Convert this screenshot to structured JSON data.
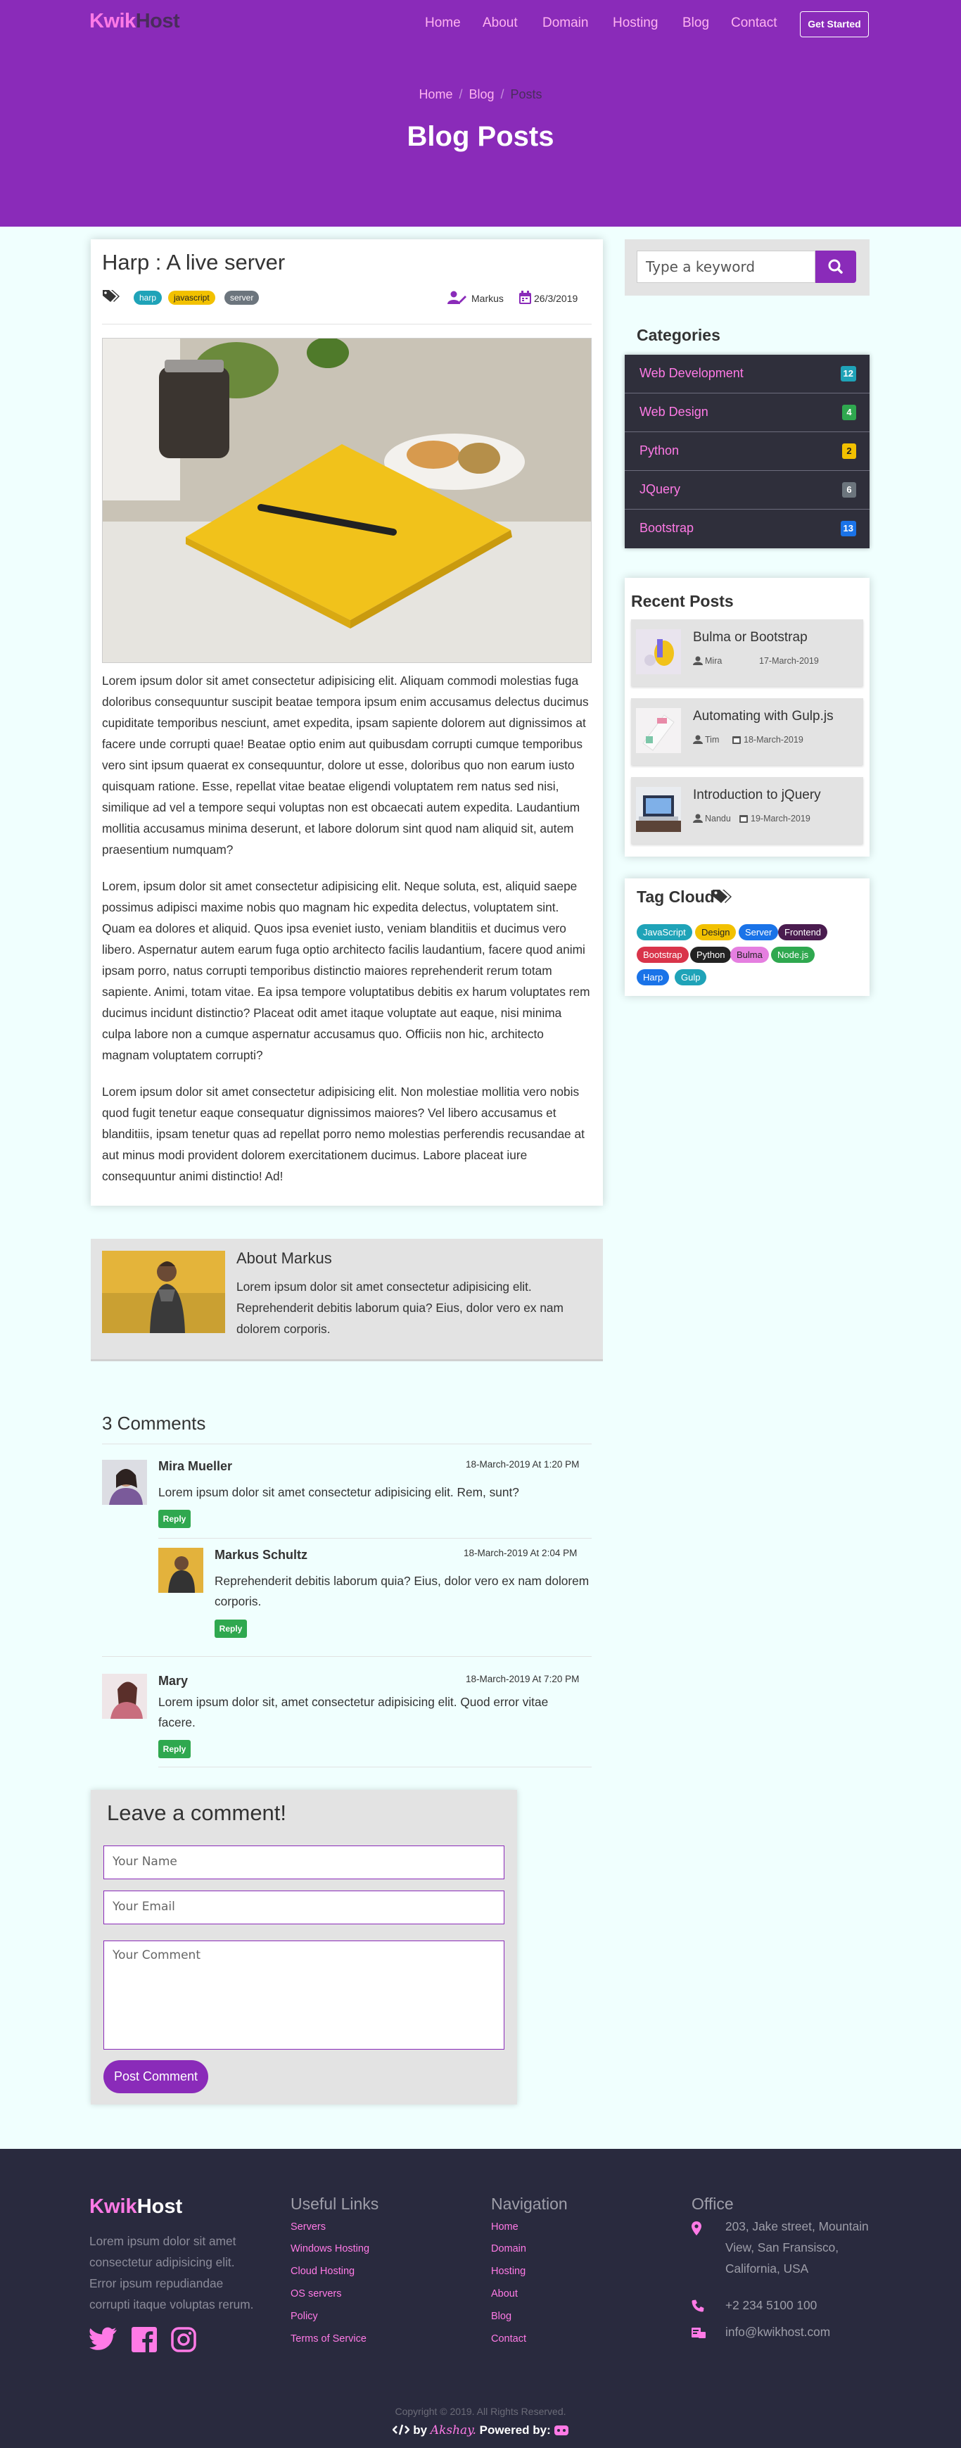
{
  "brand": {
    "part1": "Kwik",
    "part2": "Host",
    "primary": "#8a2bb9",
    "accent": "#ff7ae6",
    "footer_bg": "#292a3e"
  },
  "nav": {
    "items": [
      "Home",
      "About",
      "Domain",
      "Hosting",
      "Blog",
      "Contact"
    ],
    "cta": "Get Started"
  },
  "breadcrumb": [
    "Home",
    "Blog",
    "Posts"
  ],
  "breadcrumb_sep": "/",
  "hero_title": "Blog Posts",
  "post": {
    "title": "Harp : A live server",
    "tags": [
      {
        "label": "harp",
        "color": "#1fa3b8"
      },
      {
        "label": "javascript",
        "color": "#f2c100"
      },
      {
        "label": "server",
        "color": "#6c757d"
      }
    ],
    "author": "Markus",
    "date": "26/3/2019",
    "paragraphs": [
      "Lorem ipsum dolor sit amet consectetur adipisicing elit. Aliquam commodi molestias fuga doloribus consequuntur suscipit beatae tempora ipsum enim accusamus delectus ducimus cupiditate temporibus nesciunt, amet expedita, ipsam sapiente dolorem aut dignissimos at facere unde corrupti quae! Beatae optio enim aut quibusdam corrupti cumque temporibus vero sint ipsum quaerat ex consequuntur, dolore ut esse, doloribus quo non earum iusto quisquam ratione. Esse, repellat vitae beatae eligendi voluptatem rem natus sed nisi, similique ad vel a tempore sequi voluptas non est obcaecati autem expedita. Laudantium mollitia accusamus minima deserunt, et labore dolorum sint quod nam aliquid sit, autem praesentium numquam?",
      "Lorem, ipsum dolor sit amet consectetur adipisicing elit. Neque soluta, est, aliquid saepe possimus adipisci maxime nobis quo magnam hic expedita delectus, voluptatem sint. Quam ea dolores et aliquid. Quos ipsa eveniet iusto, veniam blanditiis et ducimus vero libero. Aspernatur autem earum fuga optio architecto facilis laudantium, facere quod animi ipsam porro, natus corrupti temporibus distinctio maiores reprehenderit rerum totam sapiente. Animi, totam vitae. Ea ipsa tempore voluptatibus debitis ex harum voluptates rem ducimus incidunt distinctio? Placeat odit amet itaque voluptate aut eaque, nisi minima culpa labore non a cumque aspernatur accusamus quo. Officiis non hic, architecto magnam voluptatem corrupti?",
      "Lorem ipsum dolor sit amet consectetur adipisicing elit. Non molestiae mollitia vero nobis quod fugit tenetur eaque consequatur dignissimos maiores? Vel libero accusamus et blanditiis, ipsam tenetur quas ad repellat porro nemo molestias perferendis recusandae at aut minus modi provident dolorem exercitationem ducimus. Labore placeat iure consequuntur animi distinctio! Ad!"
    ]
  },
  "about": {
    "title": "About Markus",
    "text": "Lorem ipsum dolor sit amet consectetur adipisicing elit. Reprehenderit debitis laborum quia? Eius, dolor vero ex nam dolorem corporis."
  },
  "comments": {
    "title": "3 Comments",
    "items": [
      {
        "name": "Mira Mueller",
        "date": "18-March-2019 At 1:20 PM",
        "text": "Lorem ipsum dolor sit amet consectetur adipisicing elit. Rem, sunt?",
        "reply": "Reply"
      },
      {
        "name": "Markus Schultz",
        "date": "18-March-2019 At 2:04 PM",
        "text": "Reprehenderit debitis laborum quia? Eius, dolor vero ex nam dolorem corporis.",
        "reply": "Reply"
      },
      {
        "name": "Mary",
        "date": "18-March-2019 At 7:20 PM",
        "text": "Lorem ipsum dolor sit, amet consectetur adipisicing elit. Quod error vitae facere.",
        "reply": "Reply"
      }
    ]
  },
  "form": {
    "title": "Leave a comment!",
    "name_placeholder": "Your Name",
    "email_placeholder": "Your Email",
    "comment_placeholder": "Your Comment",
    "submit": "Post Comment"
  },
  "sidebar": {
    "search_placeholder": "Type a keyword",
    "categories_title": "Categories",
    "categories": [
      {
        "label": "Web Development",
        "count": "12",
        "color": "#1fa3b8"
      },
      {
        "label": "Web Design",
        "count": "4",
        "color": "#2fa84f"
      },
      {
        "label": "Python",
        "count": "2",
        "color": "#f2c100"
      },
      {
        "label": "JQuery",
        "count": "6",
        "color": "#6c757d"
      },
      {
        "label": "Bootstrap",
        "count": "13",
        "color": "#1a73e8"
      }
    ],
    "recent_title": "Recent Posts",
    "recent": [
      {
        "title": "Bulma or Bootstrap",
        "author": "Mira",
        "date": "17-March-2019"
      },
      {
        "title": "Automating with Gulp.js",
        "author": "Tim",
        "date": "18-March-2019"
      },
      {
        "title": "Introduction to jQuery",
        "author": "Nandu",
        "date": "19-March-2019"
      }
    ],
    "tagcloud_title": "Tag Cloud",
    "tags": [
      {
        "label": "JavaScript",
        "color": "#1fa3b8"
      },
      {
        "label": "Design",
        "color": "#f2c100"
      },
      {
        "label": "Server",
        "color": "#1a73e8"
      },
      {
        "label": "Frontend",
        "color": "#4a1c4f"
      },
      {
        "label": "Bootstrap",
        "color": "#d9344a"
      },
      {
        "label": "Python",
        "color": "#222222"
      },
      {
        "label": "Bulma",
        "color": "#e57fe0"
      },
      {
        "label": "Node.js",
        "color": "#2fa84f"
      },
      {
        "label": "Harp",
        "color": "#1a73e8"
      },
      {
        "label": "Gulp",
        "color": "#1fa3b8"
      }
    ]
  },
  "footer": {
    "desc": "Lorem ipsum dolor sit amet consectetur adipisicing elit. Error ipsum repudiandae corrupti itaque voluptas rerum.",
    "useful_title": "Useful Links",
    "useful": [
      "Servers",
      "Windows Hosting",
      "Cloud Hosting",
      "OS servers",
      "Policy",
      "Terms of Service"
    ],
    "nav_title": "Navigation",
    "nav": [
      "Home",
      "Domain",
      "Hosting",
      "About",
      "Blog",
      "Contact"
    ],
    "office_title": "Office",
    "address": "203, Jake street, Mountain View, San Fransisco, California, USA",
    "phone": "+2 234 5100 100",
    "email": "info@kwikhost.com",
    "copyright": "Copyright © 2019. All Rights Reserved.",
    "by": "by",
    "author": "Akshay.",
    "powered": "Powered by:"
  }
}
